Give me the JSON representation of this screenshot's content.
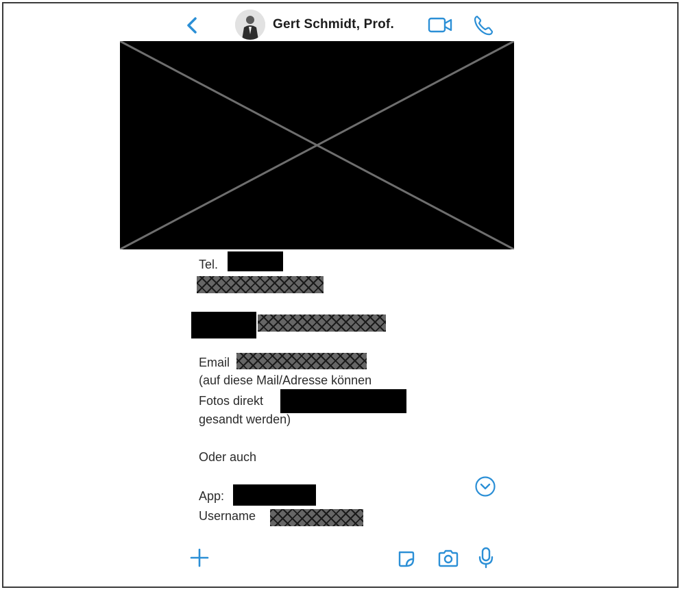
{
  "header": {
    "contact_name": "Gert Schmidt, Prof.",
    "icons": {
      "back": "chevron-left-icon",
      "video": "video-camera-icon",
      "call": "phone-icon"
    }
  },
  "message": {
    "tel_label": "Tel.",
    "email_label": "Email",
    "email_note_1": "(auf diese Mail/Adresse können",
    "email_note_2": "Fotos direkt",
    "email_note_3": "gesandt werden)",
    "alt_text": "Oder auch",
    "app_label": "App:",
    "username_label": "Username"
  },
  "composer": {
    "icons": [
      "plus-icon",
      "sticker-icon",
      "camera-icon",
      "microphone-icon"
    ]
  },
  "colors": {
    "accent": "#2b8fd6",
    "text": "#2a2a2a",
    "redaction": "#000000"
  }
}
